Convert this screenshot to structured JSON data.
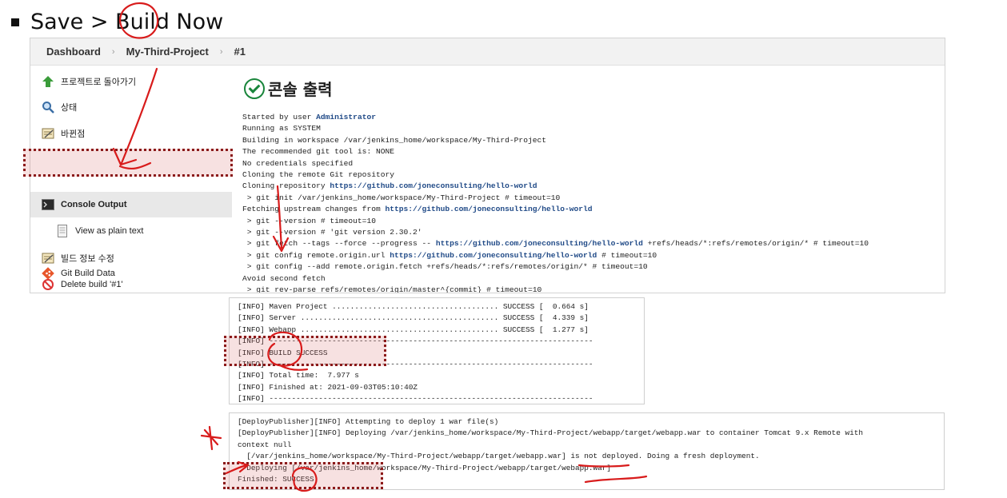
{
  "heading": {
    "text": "Save > Build Now"
  },
  "breadcrumb": [
    "Dashboard",
    "My-Third-Project",
    "#1"
  ],
  "sidebar": {
    "items": [
      {
        "label": "프로젝트로 돌아가기",
        "icon": "up-arrow-icon"
      },
      {
        "label": "상태",
        "icon": "magnifier-icon"
      },
      {
        "label": "바뀐점",
        "icon": "notepad-icon"
      },
      {
        "label": "Console Output",
        "icon": "terminal-icon"
      },
      {
        "label": "View as plain text",
        "icon": "document-icon"
      },
      {
        "label": "빌드 정보 수정",
        "icon": "notepad-icon"
      },
      {
        "label": "Delete build '#1'",
        "icon": "no-entry-icon"
      },
      {
        "label": "Git Build Data",
        "icon": "git-icon"
      }
    ]
  },
  "console": {
    "title": "콘솔 출력",
    "started_prefix": "Started by user ",
    "started_user": "Administrator",
    "lines": {
      "l2": "Running as SYSTEM",
      "l3": "Building in workspace /var/jenkins_home/workspace/My-Third-Project",
      "l4": "The recommended git tool is: NONE",
      "l5": "No credentials specified",
      "l6": "Cloning the remote Git repository",
      "l7_prefix": "Cloning repository ",
      "l7_link": "https://github.com/joneconsulting/hello-world",
      "l8": " > git init /var/jenkins_home/workspace/My-Third-Project # timeout=10",
      "l9_prefix": "Fetching upstream changes from ",
      "l9_link": "https://github.com/joneconsulting/hello-world",
      "l10": " > git --version # timeout=10",
      "l11": " > git --version # 'git version 2.30.2'",
      "l12_prefix": " > git fetch --tags --force --progress -- ",
      "l12_link": "https://github.com/joneconsulting/hello-world",
      "l12_suffix": " +refs/heads/*:refs/remotes/origin/* # timeout=10",
      "l13_prefix": " > git config remote.origin.url ",
      "l13_link": "https://github.com/joneconsulting/hello-world",
      "l13_suffix": " # timeout=10",
      "l14": " > git config --add remote.origin.fetch +refs/heads/*:refs/remotes/origin/* # timeout=10",
      "l15": "Avoid second fetch",
      "l16": " > git rev-parse refs/remotes/origin/master^{commit} # timeout=10"
    }
  },
  "build_log": [
    "[INFO] Maven Project ..................................... SUCCESS [  0.664 s]",
    "[INFO] Server ............................................ SUCCESS [  4.339 s]",
    "[INFO] Webapp ............................................ SUCCESS [  1.277 s]",
    "[INFO] ------------------------------------------------------------------------",
    "[INFO] BUILD SUCCESS",
    "[INFO] ------------------------------------------------------------------------",
    "[INFO] Total time:  7.977 s",
    "[INFO] Finished at: 2021-09-03T05:10:40Z",
    "[INFO] ------------------------------------------------------------------------"
  ],
  "deploy_log": [
    "[DeployPublisher][INFO] Attempting to deploy 1 war file(s)",
    "[DeployPublisher][INFO] Deploying /var/jenkins_home/workspace/My-Third-Project/webapp/target/webapp.war to container Tomcat 9.x Remote with",
    "context null",
    "  [/var/jenkins_home/workspace/My-Third-Project/webapp/target/webapp.war] is not deployed. Doing a fresh deployment.",
    "  Deploying [/var/jenkins_home/workspace/My-Third-Project/webapp/target/webapp.war]",
    "Finished: SUCCESS"
  ],
  "colors": {
    "link": "#204a87",
    "success_icon": "#19853b",
    "annotation": "#d81b1b",
    "highlight_border": "#8b1a1a"
  }
}
